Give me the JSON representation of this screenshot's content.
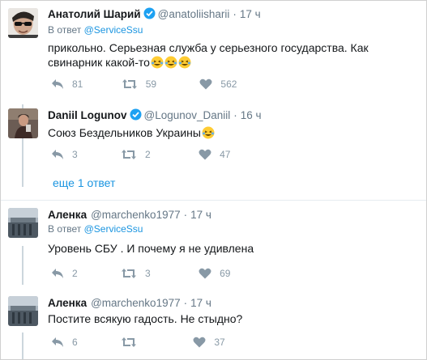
{
  "tweets": [
    {
      "name": "Анатолий Шарий",
      "verified": true,
      "handle": "@anatoliisharii",
      "time": "17 ч",
      "reply_prefix": "В ответ",
      "reply_handle": "@ServiceSsu",
      "text": "прикольно. Серьезная служба у серьезного государства. Как свинарник какой-то",
      "emoji_count": 3,
      "replies": "81",
      "retweets": "59",
      "likes": "562"
    },
    {
      "name": "Daniil Logunov",
      "verified": true,
      "handle": "@Logunov_Daniil",
      "time": "16 ч",
      "text": "Союз Бездельников Украины",
      "emoji_count": 1,
      "replies": "3",
      "retweets": "2",
      "likes": "47"
    },
    {
      "name": "Аленка",
      "verified": false,
      "handle": "@marchenko1977",
      "time": "17 ч",
      "reply_prefix": "В ответ",
      "reply_handle": "@ServiceSsu",
      "text": "Уровень СБУ . И почему я не удивлена",
      "emoji_count": 0,
      "replies": "2",
      "retweets": "3",
      "likes": "69"
    },
    {
      "name": "Аленка",
      "verified": false,
      "handle": "@marchenko1977",
      "time": "17 ч",
      "text": "Постите всякую гадость. Не стыдно?",
      "emoji_count": 0,
      "replies": "6",
      "retweets": "",
      "likes": "37"
    }
  ],
  "more_replies": "еще 1 ответ",
  "colors": {
    "link": "#1b95e0",
    "muted": "#657786",
    "icon": "#8899a6",
    "verified": "#1da1f2"
  }
}
